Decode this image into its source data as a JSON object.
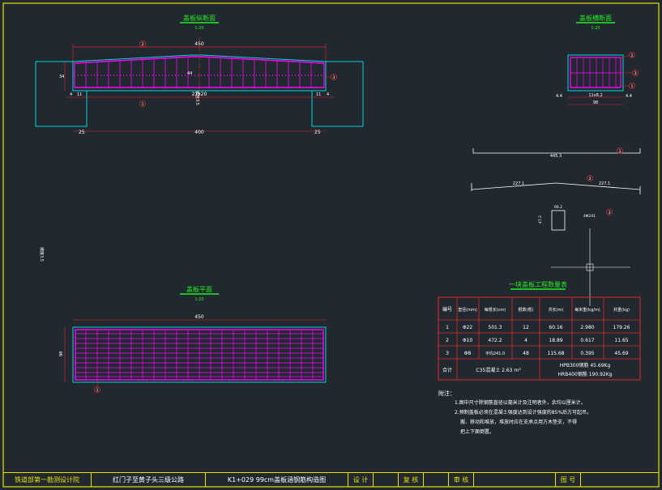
{
  "views": {
    "longitudinal": {
      "title": "盖板纵断面",
      "scale": "1:20"
    },
    "transverse": {
      "title": "盖板横断面",
      "scale": "1:20"
    },
    "plan": {
      "title": "盖板平面",
      "scale": "1:20"
    },
    "table_title": "一块盖板工程数量表"
  },
  "dims": {
    "long_top": "450",
    "long_bottom": "400",
    "long_spacing": "21x20",
    "left_edge": "25",
    "right_edge": "25",
    "small_11": "11",
    "small_4": "4",
    "height_34": "34",
    "height_44": "44",
    "slope_note": "坡度3.5",
    "trans_width": "98",
    "trans_inner": "11x8.2",
    "trans_side": "4.4",
    "plan_width": "450",
    "plan_height": "98",
    "bar1_len": "445.3",
    "bar2_len": "227.1",
    "stirrup_a": "66.2",
    "stirrup_b": "47.2",
    "stirrup_note": "4Φ241"
  },
  "callouts": [
    "1",
    "2",
    "3"
  ],
  "table": {
    "headers": [
      "编号",
      "直径(mm)",
      "每根长(cm)",
      "根数(根)",
      "共长(m)",
      "每米重(kg/m)",
      "共重(kg)"
    ],
    "rows": [
      [
        "1",
        "Φ22",
        "501.3",
        "12",
        "60.16",
        "2.980",
        "179.26"
      ],
      [
        "2",
        "Φ10",
        "472.2",
        "4",
        "18.89",
        "0.617",
        "11.65"
      ],
      [
        "3",
        "Φ8",
        "平均241.0",
        "48",
        "115.68",
        "0.395",
        "45.69"
      ]
    ],
    "total_label": "合计",
    "total_concrete": "C35混凝土 2.63 m³",
    "total_hpb": "HPB300钢筋 45.69Kg",
    "total_hrb": "HRB400钢筋 190.92Kg"
  },
  "notes": {
    "title": "附注：",
    "lines": [
      "1.图中尺寸除钢筋直径以毫米计及注明者外，余均以厘米计。",
      "2.预制盖板必须在混凝土强度达到设计强度的85%后方可起吊，",
      "搬、移动和堆放，堆放时应在支承点用方木垫支，不得",
      "把上下面倒置。"
    ]
  },
  "title_block": {
    "org": "铁道部第一勘测设计院",
    "project": "红门子至黄子头三级公路",
    "drawing": "K1+029 99cm盖板涵钢筋构造图",
    "design": "设 计",
    "review": "复 核",
    "approve": "审 核",
    "sheet": "图 号"
  },
  "colors": {
    "background": "#212830",
    "concrete": "#00d8d8",
    "rebar": "#ff00ff",
    "dimension": "#e02828",
    "title": "#22ee22",
    "frame": "#e8e000",
    "text": "#ffffff"
  }
}
